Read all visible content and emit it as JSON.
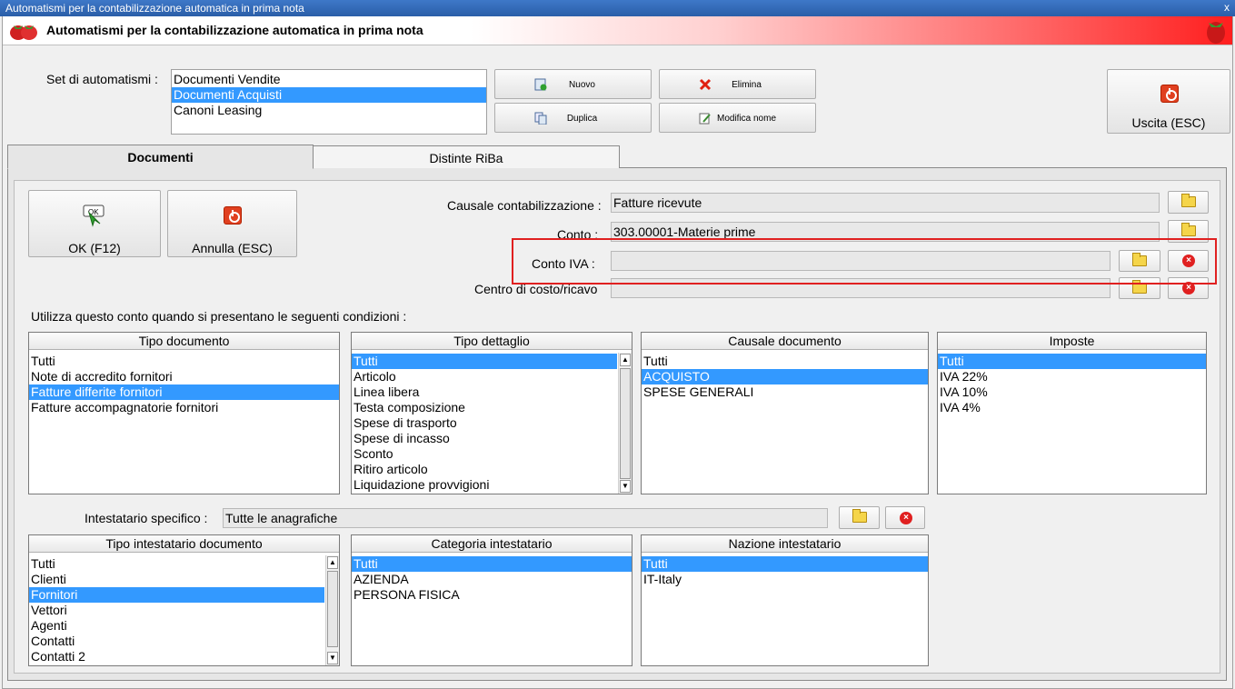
{
  "window": {
    "title": "Automatismi per la contabilizzazione automatica in prima nota",
    "header_title": "Automatismi per la contabilizzazione automatica in prima nota",
    "close_glyph": "x"
  },
  "set": {
    "label": "Set di automatismi :",
    "items": [
      "Documenti Vendite",
      "Documenti Acquisti",
      "Canoni Leasing"
    ],
    "selected_index": 1
  },
  "toolbar": {
    "nuovo": "Nuovo",
    "elimina": "Elimina",
    "duplica": "Duplica",
    "modifica_nome": "Modifica nome",
    "uscita": "Uscita (ESC)"
  },
  "tabs": [
    "Documenti",
    "Distinte RiBa"
  ],
  "actions": {
    "ok": "OK (F12)",
    "annulla": "Annulla (ESC)",
    "ok_icon_text": "OK"
  },
  "fields": {
    "causale_label": "Causale contabilizzazione :",
    "causale_value": "Fatture ricevute",
    "conto_label": "Conto :",
    "conto_value": "303.00001-Materie prime",
    "conto_iva_label": "Conto IVA :",
    "conto_iva_value": "",
    "centro_label": "Centro di costo/ricavo",
    "centro_value": ""
  },
  "conditions_label": "Utilizza questo conto quando si presentano le seguenti condizioni :",
  "lists": {
    "tipo_documento": {
      "header": "Tipo documento",
      "items": [
        "Tutti",
        "Note di accredito fornitori",
        "Fatture differite fornitori",
        "Fatture accompagnatorie fornitori"
      ],
      "selected_index": 2
    },
    "tipo_dettaglio": {
      "header": "Tipo dettaglio",
      "items": [
        "Tutti",
        "Articolo",
        "Linea libera",
        "Testa composizione",
        "Spese di trasporto",
        "Spese di incasso",
        "Sconto",
        "Ritiro articolo",
        "Liquidazione provvigioni"
      ],
      "selected_index": 0
    },
    "causale_documento": {
      "header": "Causale documento",
      "items": [
        "Tutti",
        "ACQUISTO",
        "SPESE GENERALI"
      ],
      "selected_index": 1
    },
    "imposte": {
      "header": "Imposte",
      "items": [
        "Tutti",
        "IVA 22%",
        "IVA 10%",
        "IVA 4%"
      ],
      "selected_index": 0
    },
    "tipo_intestatario": {
      "header": "Tipo intestatario documento",
      "items": [
        "Tutti",
        "Clienti",
        "Fornitori",
        "Vettori",
        "Agenti",
        "Contatti",
        "Contatti 2"
      ],
      "selected_index": 2
    },
    "categoria_intestatario": {
      "header": "Categoria intestatario",
      "items": [
        "Tutti",
        "AZIENDA",
        "PERSONA FISICA"
      ],
      "selected_index": 0
    },
    "nazione_intestatario": {
      "header": "Nazione intestatario",
      "items": [
        "Tutti",
        "IT-Italy"
      ],
      "selected_index": 0
    }
  },
  "intestatario": {
    "label": "Intestatario specifico :",
    "value": "Tutte le anagrafiche"
  },
  "colors": {
    "selection": "#3399ff",
    "highlight_box": "#e02020",
    "header_gradient_end": "#ff1e1e"
  }
}
